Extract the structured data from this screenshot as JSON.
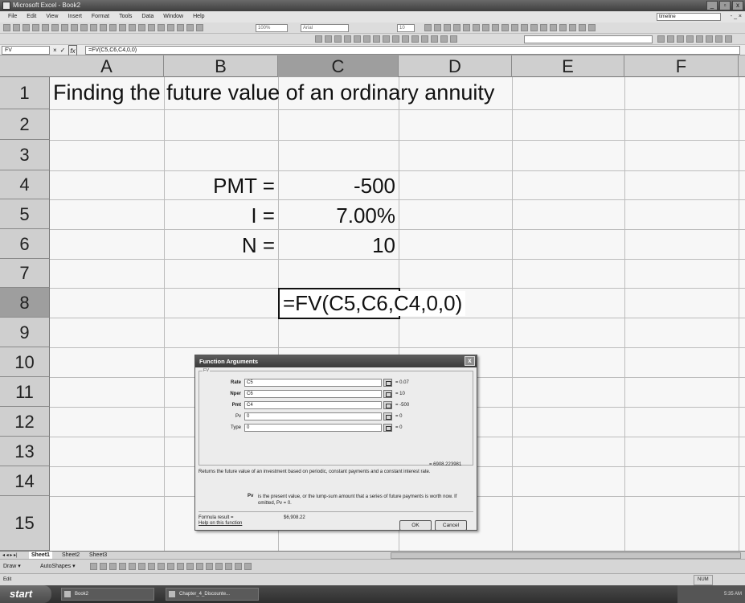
{
  "window": {
    "title": "Microsoft Excel - Book2",
    "controls": [
      "_",
      "▫",
      "x"
    ]
  },
  "menu": {
    "items": [
      "File",
      "Edit",
      "View",
      "Insert",
      "Format",
      "Tools",
      "Data",
      "Window",
      "Help"
    ],
    "ask_box": "timeline",
    "doc_controls": "- _ ×"
  },
  "toolbar": {
    "zoom": "100%",
    "font": "Arial",
    "size": "10"
  },
  "formula_bar": {
    "name_box": "FV",
    "cancel": "×",
    "enter": "✓",
    "fx": "fx",
    "formula": "=FV(C5,C6,C4,0,0)"
  },
  "grid": {
    "columns": [
      "A",
      "B",
      "C",
      "D",
      "E",
      "F"
    ],
    "active_column": "C",
    "rows": [
      "1",
      "2",
      "3",
      "4",
      "5",
      "6",
      "7",
      "8",
      "9",
      "10",
      "11",
      "12",
      "13",
      "14",
      "15"
    ],
    "active_row": "8",
    "cells": {
      "a1": "Finding the future value of an ordinary annuity",
      "b4": "PMT =",
      "c4": "-500",
      "b5": "I =",
      "c5": "7.00%",
      "b6": "N =",
      "c6": "10",
      "c8": "=FV(C5,C6,C4,0,0)"
    }
  },
  "dialog": {
    "title": "Function Arguments",
    "close": "x",
    "function_name": "FV",
    "args": [
      {
        "label": "Rate",
        "value": "C5",
        "result": "= 0.07",
        "bold": true
      },
      {
        "label": "Nper",
        "value": "C6",
        "result": "= 10",
        "bold": true
      },
      {
        "label": "Pmt",
        "value": "C4",
        "result": "= -500",
        "bold": true
      },
      {
        "label": "Pv",
        "value": "0",
        "result": "= 0",
        "bold": false
      },
      {
        "label": "Type",
        "value": "0",
        "result": "= 0",
        "bold": false
      }
    ],
    "result": "= 6908.223981",
    "description": "Returns the future value of an investment based on periodic, constant payments and a constant interest rate.",
    "arg_name": "Pv",
    "arg_description": "is the present value, or the lump-sum amount that a series of future payments is worth now. If omitted, Pv = 0.",
    "formula_result_label": "Formula result =",
    "formula_result_value": "$6,908.22",
    "help_link": "Help on this function",
    "ok": "OK",
    "cancel": "Cancel"
  },
  "sheets": {
    "nav": "◂ ◂ ▸ ▸|",
    "tabs": [
      "Sheet1",
      "Sheet2",
      "Sheet3"
    ],
    "active": "Sheet1"
  },
  "drawbar": {
    "draw": "Draw ▾",
    "autoshapes": "AutoShapes ▾"
  },
  "status": {
    "mode": "Edit",
    "num": "NUM"
  },
  "taskbar": {
    "start": "start",
    "items": [
      "Book2",
      "Chapter_4_Discounte..."
    ],
    "clock": "5:35 AM"
  }
}
